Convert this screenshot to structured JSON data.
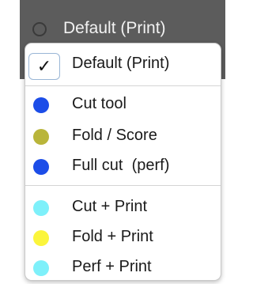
{
  "current": {
    "label": "Default (Print)"
  },
  "menu": {
    "selected": {
      "label": "Default (Print)",
      "check_icon": "checkmark-icon",
      "check_glyph": "✓"
    },
    "group1": [
      {
        "label": "Cut tool",
        "color": "#1c4de8"
      },
      {
        "label": "Fold / Score",
        "color": "#b9b53a"
      },
      {
        "label": "Full cut  (perf)",
        "color": "#1c4de8"
      }
    ],
    "group2": [
      {
        "label": "Cut + Print",
        "color": "#7ef0fa"
      },
      {
        "label": "Fold + Print",
        "color": "#fbf53c"
      },
      {
        "label": "Perf + Print",
        "color": "#7ef0fa"
      }
    ]
  }
}
